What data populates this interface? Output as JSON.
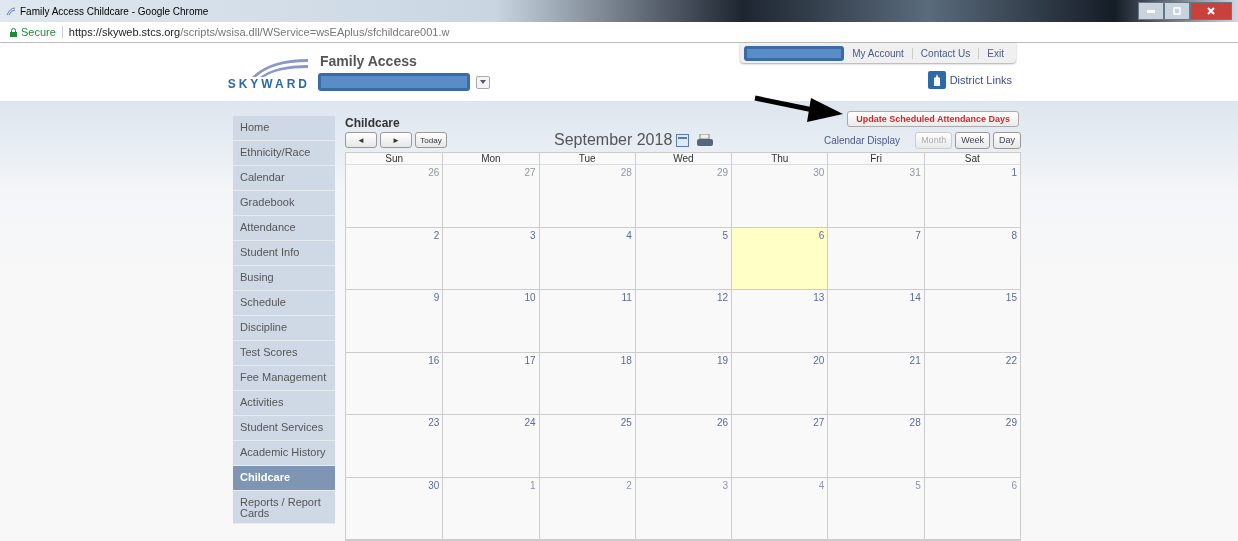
{
  "window": {
    "title": "Family Access Childcare - Google Chrome"
  },
  "address_bar": {
    "security": "Secure",
    "url_host": "https://skyweb.stcs.org",
    "url_path": "/scripts/wsisa.dll/WService=wsEAplus/sfchildcare001.w"
  },
  "header": {
    "logo": "SKYWARD",
    "app_title": "Family Access",
    "top_links": [
      "My Account",
      "Contact Us",
      "Exit"
    ],
    "district_links": "District Links"
  },
  "sidebar": {
    "items": [
      {
        "label": "Home",
        "selected": false
      },
      {
        "label": "Ethnicity/Race",
        "selected": false
      },
      {
        "label": "Calendar",
        "selected": false
      },
      {
        "label": "Gradebook",
        "selected": false
      },
      {
        "label": "Attendance",
        "selected": false
      },
      {
        "label": "Student Info",
        "selected": false
      },
      {
        "label": "Busing",
        "selected": false
      },
      {
        "label": "Schedule",
        "selected": false
      },
      {
        "label": "Discipline",
        "selected": false
      },
      {
        "label": "Test Scores",
        "selected": false
      },
      {
        "label": "Fee Management",
        "selected": false
      },
      {
        "label": "Activities",
        "selected": false
      },
      {
        "label": "Student Services",
        "selected": false
      },
      {
        "label": "Academic History",
        "selected": false
      },
      {
        "label": "Childcare",
        "selected": true
      },
      {
        "label": "Reports / Report Cards",
        "selected": false
      }
    ]
  },
  "page": {
    "title": "Childcare",
    "update_button": "Update Scheduled Attendance Days"
  },
  "toolbar": {
    "prev": "◄",
    "next": "►",
    "today": "Today",
    "month_title": "September 2018",
    "display_label": "Calendar Display",
    "views": [
      {
        "label": "Month",
        "disabled": true
      },
      {
        "label": "Week",
        "disabled": false
      },
      {
        "label": "Day",
        "disabled": false
      }
    ]
  },
  "calendar": {
    "weekdays": [
      "Sun",
      "Mon",
      "Tue",
      "Wed",
      "Thu",
      "Fri",
      "Sat"
    ],
    "weeks": [
      [
        {
          "day": "26",
          "in_month": false,
          "today": false
        },
        {
          "day": "27",
          "in_month": false,
          "today": false
        },
        {
          "day": "28",
          "in_month": false,
          "today": false
        },
        {
          "day": "29",
          "in_month": false,
          "today": false
        },
        {
          "day": "30",
          "in_month": false,
          "today": false
        },
        {
          "day": "31",
          "in_month": false,
          "today": false
        },
        {
          "day": "1",
          "in_month": true,
          "today": false
        }
      ],
      [
        {
          "day": "2",
          "in_month": true,
          "today": false
        },
        {
          "day": "3",
          "in_month": true,
          "today": false
        },
        {
          "day": "4",
          "in_month": true,
          "today": false
        },
        {
          "day": "5",
          "in_month": true,
          "today": false
        },
        {
          "day": "6",
          "in_month": true,
          "today": true
        },
        {
          "day": "7",
          "in_month": true,
          "today": false
        },
        {
          "day": "8",
          "in_month": true,
          "today": false
        }
      ],
      [
        {
          "day": "9",
          "in_month": true,
          "today": false
        },
        {
          "day": "10",
          "in_month": true,
          "today": false
        },
        {
          "day": "11",
          "in_month": true,
          "today": false
        },
        {
          "day": "12",
          "in_month": true,
          "today": false
        },
        {
          "day": "13",
          "in_month": true,
          "today": false
        },
        {
          "day": "14",
          "in_month": true,
          "today": false
        },
        {
          "day": "15",
          "in_month": true,
          "today": false
        }
      ],
      [
        {
          "day": "16",
          "in_month": true,
          "today": false
        },
        {
          "day": "17",
          "in_month": true,
          "today": false
        },
        {
          "day": "18",
          "in_month": true,
          "today": false
        },
        {
          "day": "19",
          "in_month": true,
          "today": false
        },
        {
          "day": "20",
          "in_month": true,
          "today": false
        },
        {
          "day": "21",
          "in_month": true,
          "today": false
        },
        {
          "day": "22",
          "in_month": true,
          "today": false
        }
      ],
      [
        {
          "day": "23",
          "in_month": true,
          "today": false
        },
        {
          "day": "24",
          "in_month": true,
          "today": false
        },
        {
          "day": "25",
          "in_month": true,
          "today": false
        },
        {
          "day": "26",
          "in_month": true,
          "today": false
        },
        {
          "day": "27",
          "in_month": true,
          "today": false
        },
        {
          "day": "28",
          "in_month": true,
          "today": false
        },
        {
          "day": "29",
          "in_month": true,
          "today": false
        }
      ],
      [
        {
          "day": "30",
          "in_month": true,
          "today": false
        },
        {
          "day": "1",
          "in_month": false,
          "today": false
        },
        {
          "day": "2",
          "in_month": false,
          "today": false
        },
        {
          "day": "3",
          "in_month": false,
          "today": false
        },
        {
          "day": "4",
          "in_month": false,
          "today": false
        },
        {
          "day": "5",
          "in_month": false,
          "today": false
        },
        {
          "day": "6",
          "in_month": false,
          "today": false
        }
      ]
    ]
  }
}
